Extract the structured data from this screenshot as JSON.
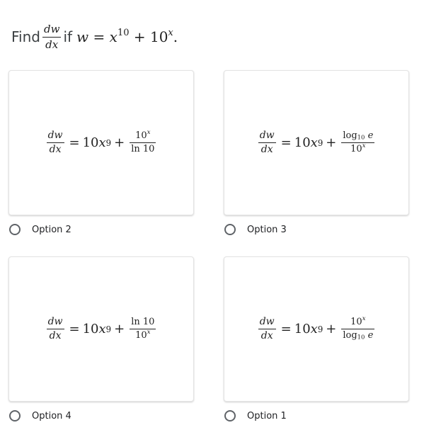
{
  "question": {
    "find_word": "Find",
    "derivative_num": "dw",
    "derivative_den": "dx",
    "if_word": "if",
    "w_var": "w",
    "equals": "=",
    "x_var": "x",
    "x_exp": "10",
    "plus": "+",
    "ten": "10",
    "ten_exp": "x",
    "period": "."
  },
  "options": [
    {
      "label": "Option 2",
      "selected": false,
      "equation": {
        "lhs_num": "dw",
        "lhs_den": "dx",
        "eq": "=",
        "coef": "10",
        "var": "x",
        "exp": "9",
        "plus": "+",
        "num": "10",
        "num_exp": "x",
        "num_sub": "",
        "num_tail": "",
        "den": "ln 10",
        "den_exp": "",
        "den_sub": "",
        "den_tail": ""
      }
    },
    {
      "label": "Option 3",
      "selected": false,
      "equation": {
        "lhs_num": "dw",
        "lhs_den": "dx",
        "eq": "=",
        "coef": "10",
        "var": "x",
        "exp": "9",
        "plus": "+",
        "num": "log",
        "num_exp": "",
        "num_sub": "10",
        "num_tail": "e",
        "den": "10",
        "den_exp": "x",
        "den_sub": "",
        "den_tail": ""
      }
    },
    {
      "label": "Option 4",
      "selected": false,
      "equation": {
        "lhs_num": "dw",
        "lhs_den": "dx",
        "eq": "=",
        "coef": "10",
        "var": "x",
        "exp": "9",
        "plus": "+",
        "num": "ln 10",
        "num_exp": "",
        "num_sub": "",
        "num_tail": "",
        "den": "10",
        "den_exp": "x",
        "den_sub": "",
        "den_tail": ""
      }
    },
    {
      "label": "Option 1",
      "selected": false,
      "equation": {
        "lhs_num": "dw",
        "lhs_den": "dx",
        "eq": "=",
        "coef": "10",
        "var": "x",
        "exp": "9",
        "plus": "+",
        "num": "10",
        "num_exp": "x",
        "num_sub": "",
        "num_tail": "",
        "den": "log",
        "den_exp": "",
        "den_sub": "10",
        "den_tail": "e"
      }
    }
  ]
}
